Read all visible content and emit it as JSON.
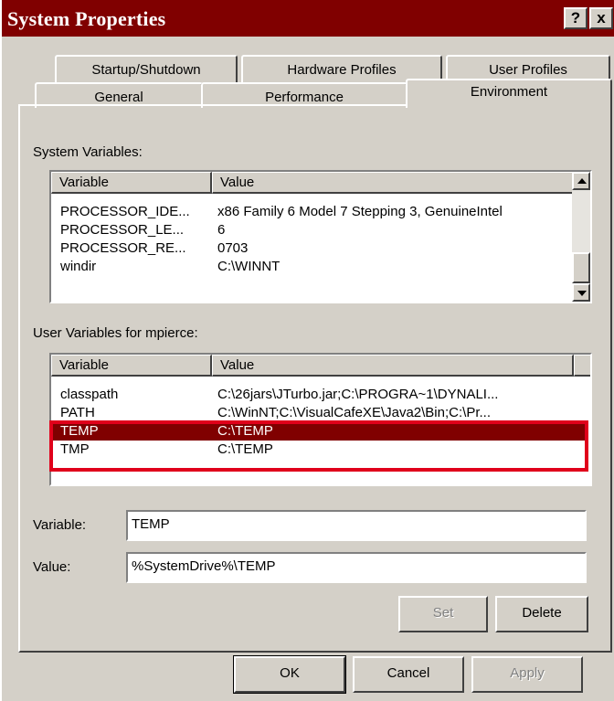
{
  "window": {
    "title": "System Properties",
    "help_btn": "?",
    "close_btn": "x"
  },
  "tabs": {
    "back_row": [
      "Startup/Shutdown",
      "Hardware Profiles",
      "User Profiles"
    ],
    "front_row": [
      "General",
      "Performance",
      "Environment"
    ],
    "active": "Environment"
  },
  "system_vars": {
    "label": "System Variables:",
    "col_variable": "Variable",
    "col_value": "Value",
    "rows": [
      {
        "name": "PROCESSOR_IDE...",
        "value": "x86 Family 6 Model 7 Stepping 3, GenuineIntel"
      },
      {
        "name": "PROCESSOR_LE...",
        "value": "6"
      },
      {
        "name": "PROCESSOR_RE...",
        "value": "0703"
      },
      {
        "name": "windir",
        "value": "C:\\WINNT"
      }
    ]
  },
  "user_vars": {
    "label": "User Variables for mpierce:",
    "col_variable": "Variable",
    "col_value": "Value",
    "rows": [
      {
        "name": "classpath",
        "value": "C:\\26jars\\JTurbo.jar;C:\\PROGRA~1\\DYNALI..."
      },
      {
        "name": "PATH",
        "value": "C:\\WinNT;C:\\VisualCafeXE\\Java2\\Bin;C:\\Pr..."
      },
      {
        "name": "TEMP",
        "value": "C:\\TEMP"
      },
      {
        "name": "TMP",
        "value": "C:\\TEMP"
      }
    ],
    "selected": "TEMP"
  },
  "fields": {
    "variable_label": "Variable:",
    "variable_value": "TEMP",
    "value_label": "Value:",
    "value_value": "%SystemDrive%\\TEMP"
  },
  "buttons": {
    "set": "Set",
    "delete": "Delete",
    "ok": "OK",
    "cancel": "Cancel",
    "apply": "Apply"
  },
  "colors": {
    "titlebar": "#800000",
    "selection": "#800000",
    "highlight_border": "#e0001b",
    "face": "#d4d0c8"
  }
}
